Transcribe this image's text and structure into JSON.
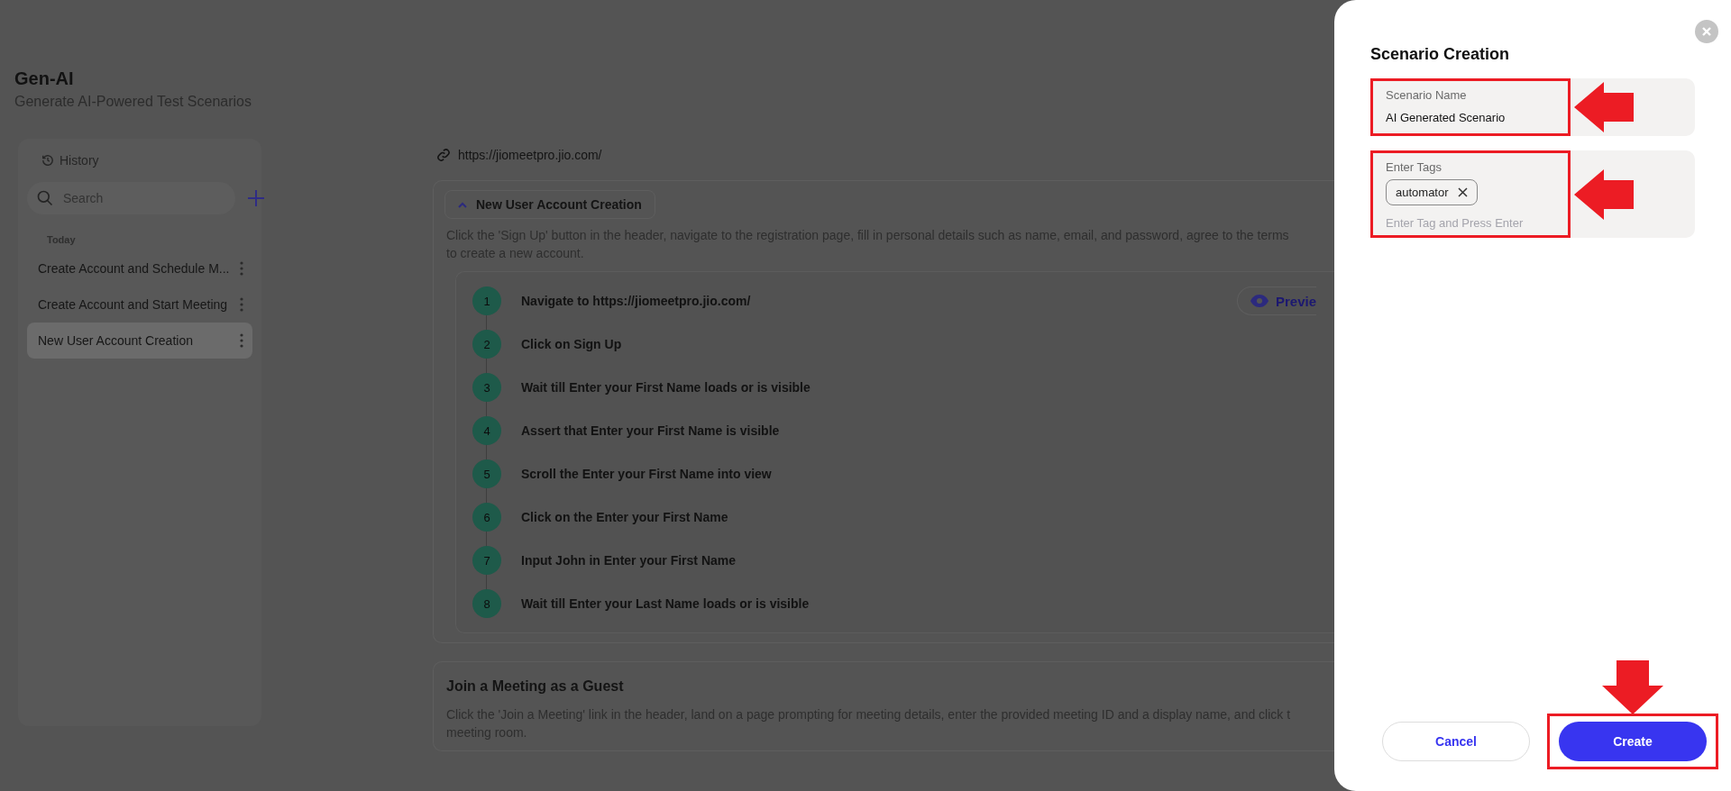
{
  "page": {
    "title": "Gen-AI",
    "subtitle": "Generate AI-Powered Test Scenarios"
  },
  "history": {
    "title": "History",
    "search": {
      "placeholder": "Search"
    },
    "group": "Today",
    "items": [
      {
        "label": "Create Account and Schedule M...",
        "selected": false
      },
      {
        "label": "Create Account and Start Meeting",
        "selected": false
      },
      {
        "label": "New User Account Creation",
        "selected": true
      }
    ]
  },
  "url": "https://jiomeetpro.jio.com/",
  "scenarios": [
    {
      "title": "New User Account Creation",
      "expanded": true,
      "description_lines": [
        "Click the 'Sign Up' button in the header, navigate to the registration page, fill in personal details such as name, email, and password, agree to the terms",
        "to create a new account."
      ],
      "preview": "Previe",
      "steps": [
        {
          "number": "1",
          "text": "Navigate to https://jiomeetpro.jio.com/"
        },
        {
          "number": "2",
          "text": "Click on Sign Up"
        },
        {
          "number": "3",
          "text": "Wait till Enter your First Name loads or is visible"
        },
        {
          "number": "4",
          "text": "Assert that Enter your First Name is visible"
        },
        {
          "number": "5",
          "text": "Scroll the Enter your First Name into view"
        },
        {
          "number": "6",
          "text": "Click on the Enter your First Name"
        },
        {
          "number": "7",
          "text": "Input John in Enter your First Name"
        },
        {
          "number": "8",
          "text": "Wait till Enter your Last Name loads or is visible"
        }
      ]
    },
    {
      "title": "Join a Meeting as a Guest",
      "expanded": false,
      "description_lines": [
        "Click the 'Join a Meeting' link in the header, land on a page prompting for meeting details, enter the provided meeting ID and a display name, and click t",
        "meeting room."
      ]
    }
  ],
  "dialog": {
    "title": "Scenario Creation",
    "fields": [
      {
        "kind": "text",
        "label": "Scenario Name",
        "value": "AI Generated Scenario",
        "annotated": true
      },
      {
        "kind": "tags",
        "label": "Enter Tags",
        "tags": [
          "automator"
        ],
        "placeholder": "Enter Tag and Press Enter",
        "annotated": true
      }
    ],
    "buttons": [
      {
        "label": "Cancel",
        "kind": "secondary",
        "annotated": false
      },
      {
        "label": "Create",
        "kind": "primary",
        "annotated": true
      }
    ]
  }
}
